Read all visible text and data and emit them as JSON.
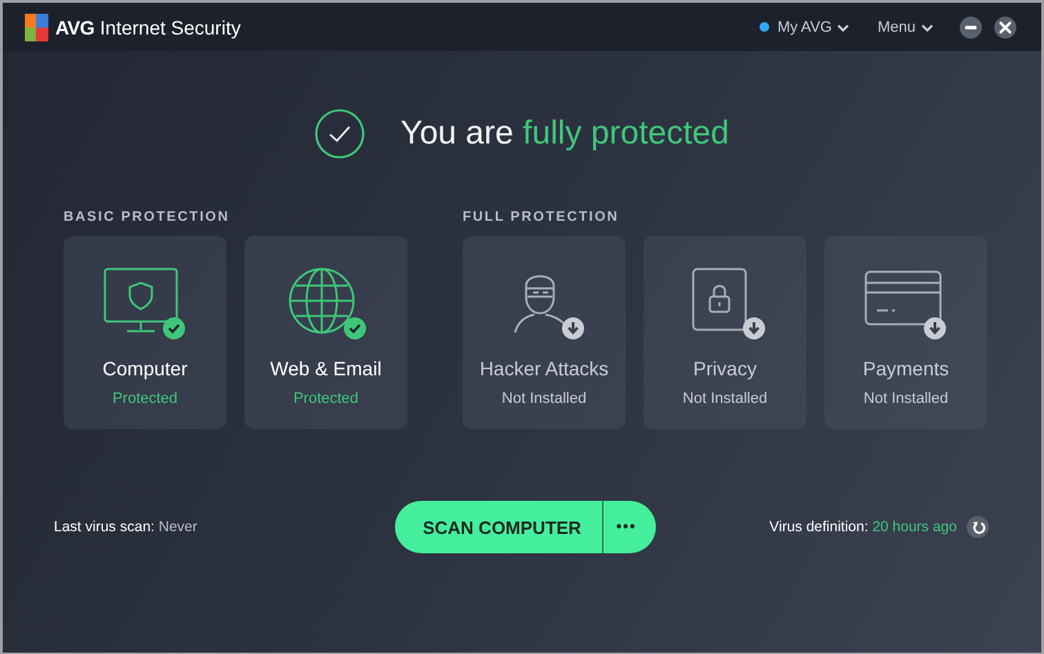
{
  "window": {
    "app_name": "AVG",
    "title": "Internet Security"
  },
  "header": {
    "account": {
      "label": "My AVG",
      "online": true
    },
    "menu": {
      "label": "Menu"
    }
  },
  "status": {
    "prefix": "You are",
    "highlight": "fully protected"
  },
  "sections": [
    {
      "title": "BASIC PROTECTION",
      "cards": [
        {
          "name": "Computer",
          "status": "Protected",
          "installed": true
        },
        {
          "name": "Web & Email",
          "status": "Protected",
          "installed": true
        }
      ]
    },
    {
      "title": "FULL PROTECTION",
      "cards": [
        {
          "name": "Hacker Attacks",
          "status": "Not Installed",
          "installed": false
        },
        {
          "name": "Privacy",
          "status": "Not Installed",
          "installed": false
        },
        {
          "name": "Payments",
          "status": "Not Installed",
          "installed": false
        }
      ]
    }
  ],
  "footer": {
    "last_scan_label": "Last virus scan:",
    "last_scan_value": "Never",
    "scan_button": "SCAN COMPUTER",
    "more_button": "•••",
    "definition_label": "Virus definition:",
    "definition_value": "20 hours ago"
  }
}
